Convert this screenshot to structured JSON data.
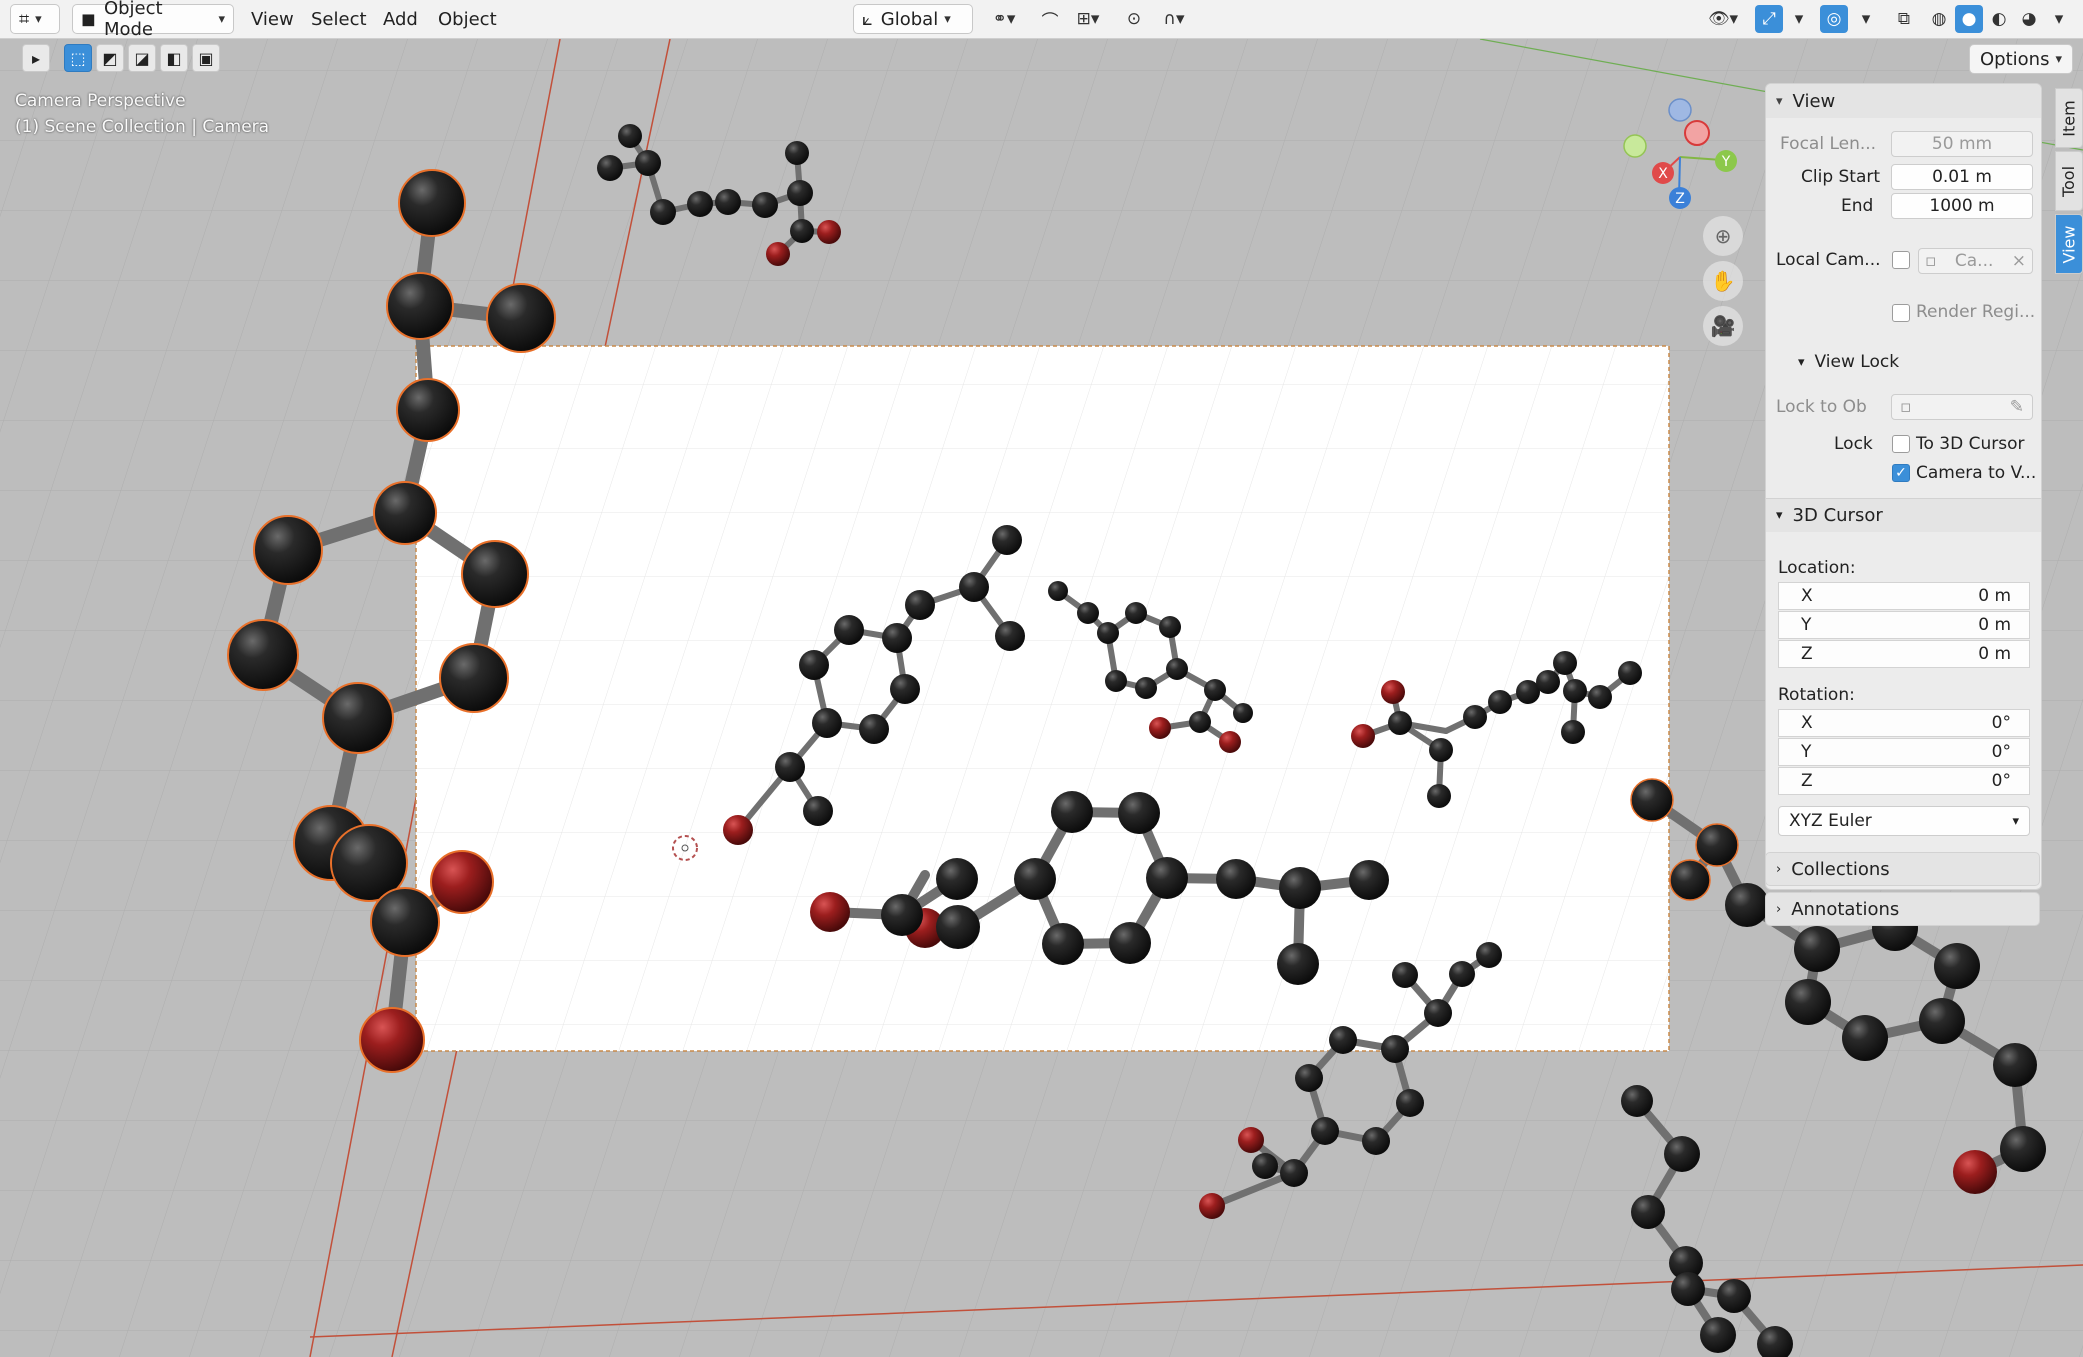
{
  "header": {
    "editor_type_icon": "editor-type-icon",
    "mode": "Object Mode",
    "menus": [
      "View",
      "Select",
      "Add",
      "Object"
    ],
    "transform_orientation": "Global",
    "accent": "#3b8fd9"
  },
  "toolbar": {
    "options_label": "Options"
  },
  "viewport": {
    "perspective_label": "Camera Perspective",
    "collection_label": "(1) Scene Collection | Camera",
    "gizmo": {
      "x": "X",
      "y": "Y",
      "z": "Z"
    }
  },
  "sidebar": {
    "tabs": [
      "Item",
      "Tool",
      "View"
    ],
    "active_tab": "View",
    "view": {
      "title": "View",
      "focal_length_label": "Focal Len...",
      "focal_length_value": "50 mm",
      "clip_start_label": "Clip Start",
      "clip_start_value": "0.01 m",
      "end_label": "End",
      "end_value": "1000 m",
      "local_camera_label": "Local Cam...",
      "local_camera_value": "Ca...",
      "render_region_label": "Render Regi...",
      "view_lock_title": "View Lock",
      "lock_to_object_label": "Lock to Ob",
      "lock_label": "Lock",
      "to_3d_cursor_label": "To 3D Cursor",
      "camera_to_view_label": "Camera to V...",
      "camera_to_view_checked": true,
      "to_3d_cursor_checked": false
    },
    "cursor": {
      "title": "3D Cursor",
      "location_label": "Location:",
      "location": [
        {
          "axis": "X",
          "value": "0 m"
        },
        {
          "axis": "Y",
          "value": "0 m"
        },
        {
          "axis": "Z",
          "value": "0 m"
        }
      ],
      "rotation_label": "Rotation:",
      "rotation": [
        {
          "axis": "X",
          "value": "0°"
        },
        {
          "axis": "Y",
          "value": "0°"
        },
        {
          "axis": "Z",
          "value": "0°"
        }
      ],
      "rotation_mode": "XYZ Euler"
    },
    "collections_title": "Collections",
    "annotations_title": "Annotations"
  }
}
